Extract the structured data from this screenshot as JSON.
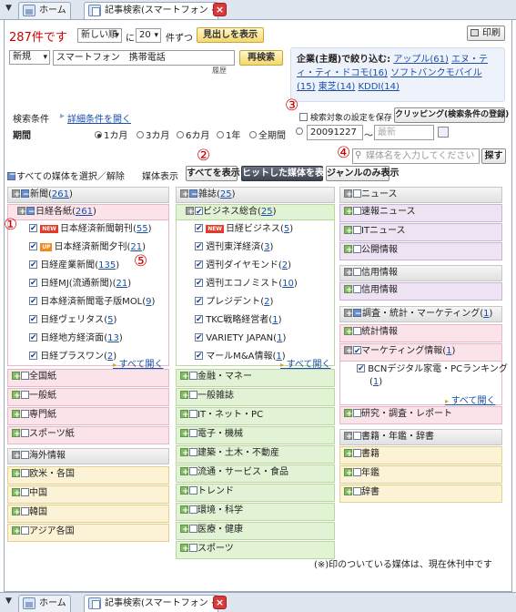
{
  "tabs": {
    "dropdown": "▼",
    "home": "ホーム",
    "search": "記事検索(スマートフォン ⋯",
    "close": "×"
  },
  "toolbar": {
    "count": "287件です",
    "sort": "新しい順",
    "per_page": "20",
    "per_page_prefix": "に",
    "per_page_suffix": "件ずつ",
    "show_headlines": "見出しを表示",
    "print": "印刷"
  },
  "search": {
    "scope": "新規",
    "query": "スマートフォン　携帯電話",
    "research": "再検索",
    "history": "履歴"
  },
  "refine": {
    "label": "企業(主題)で絞り込む:",
    "companies": [
      "アップル(61)",
      "エヌ・ティ・ティ・ドコモ(16)",
      "ソフトバンクモバイル(15)",
      "東芝(14)",
      "KDDI(14)"
    ]
  },
  "conditions": {
    "label": "検索条件",
    "detail_link": "詳細条件を開く",
    "save_settings": "検索対象の設定を保存",
    "clipping": "クリッピング(検索条件の登録)"
  },
  "period": {
    "label": "期間",
    "options": [
      "1カ月",
      "3カ月",
      "6カ月",
      "1年",
      "全期間"
    ],
    "from": "20091227",
    "tilde": "〜",
    "to_placeholder": "最新"
  },
  "media_search": {
    "placeholder": "媒体名を入力してください",
    "button": "探す"
  },
  "media_bar": {
    "select_all": "すべての媒体を選択／解除",
    "display_label": "媒体表示",
    "show_all": "すべてを表示",
    "show_hit": "ヒットした媒体を表示",
    "genre_only": "ジャンルのみ表示"
  },
  "markers": [
    "①",
    "②",
    "③",
    "④",
    "⑤"
  ],
  "col1": {
    "newspaper": "新聞",
    "newspaper_count": "261",
    "nikkei": "日経各紙",
    "nikkei_count": "261",
    "items": [
      {
        "badge": "NEW",
        "name": "日本経済新聞朝刊",
        "count": "55"
      },
      {
        "badge": "UP",
        "name": "日本経済新聞夕刊",
        "count": "21"
      },
      {
        "badge": "",
        "name": "日経産業新聞",
        "count": "135"
      },
      {
        "badge": "",
        "name": "日経MJ(流通新聞)",
        "count": "21"
      },
      {
        "badge": "",
        "name": "日本経済新聞電子版MOL",
        "count": "9"
      },
      {
        "badge": "",
        "name": "日経ヴェリタス",
        "count": "5"
      },
      {
        "badge": "",
        "name": "日経地方経済面",
        "count": "13"
      },
      {
        "badge": "",
        "name": "日経プラスワン",
        "count": "2"
      }
    ],
    "open_all": "すべて開く",
    "groups": [
      "全国紙",
      "一般紙",
      "専門紙",
      "スポーツ紙"
    ],
    "overseas": "海外情報",
    "overseas_items": [
      "欧米・各国",
      "中国",
      "韓国",
      "アジア各国"
    ]
  },
  "col2": {
    "magazine": "雑誌",
    "magazine_count": "25",
    "business": "ビジネス総合",
    "business_count": "25",
    "items": [
      {
        "badge": "NEW",
        "name": "日経ビジネス",
        "count": "5"
      },
      {
        "badge": "",
        "name": "週刊東洋経済",
        "count": "3"
      },
      {
        "badge": "",
        "name": "週刊ダイヤモンド",
        "count": "2"
      },
      {
        "badge": "",
        "name": "週刊エコノミスト",
        "count": "10"
      },
      {
        "badge": "",
        "name": "プレジデント",
        "count": "2"
      },
      {
        "badge": "",
        "name": "TKC戦略経営者",
        "count": "1"
      },
      {
        "badge": "",
        "name": "VARIETY JAPAN",
        "count": "1"
      },
      {
        "badge": "",
        "name": "マールM&A情報",
        "count": "1"
      }
    ],
    "open_all": "すべて開く",
    "groups": [
      "金融・マネー",
      "一般雑誌",
      "IT・ネット・PC",
      "電子・機械",
      "建築・土木・不動産",
      "流通・サービス・食品",
      "トレンド",
      "環境・科学",
      "医療・健康",
      "スポーツ"
    ]
  },
  "col3": {
    "news": "ニュース",
    "news_items": [
      "速報ニュース",
      "ITニュース",
      "公開情報"
    ],
    "credit": "信用情報",
    "credit_items": [
      "信用情報"
    ],
    "research": "調査・統計・マーケティング",
    "research_count": "1",
    "stats": "統計情報",
    "marketing": "マーケティング情報",
    "marketing_count": "1",
    "bcn": "BCNデジタル家電・PCランキング",
    "bcn_count": "1",
    "open_all": "すべて開く",
    "report": "研究・調査・レポート",
    "books": "書籍・年鑑・辞書",
    "books_items": [
      "書籍",
      "年鑑",
      "辞書"
    ]
  },
  "footnote": "(※)印のついている媒体は、現在休刊中です"
}
